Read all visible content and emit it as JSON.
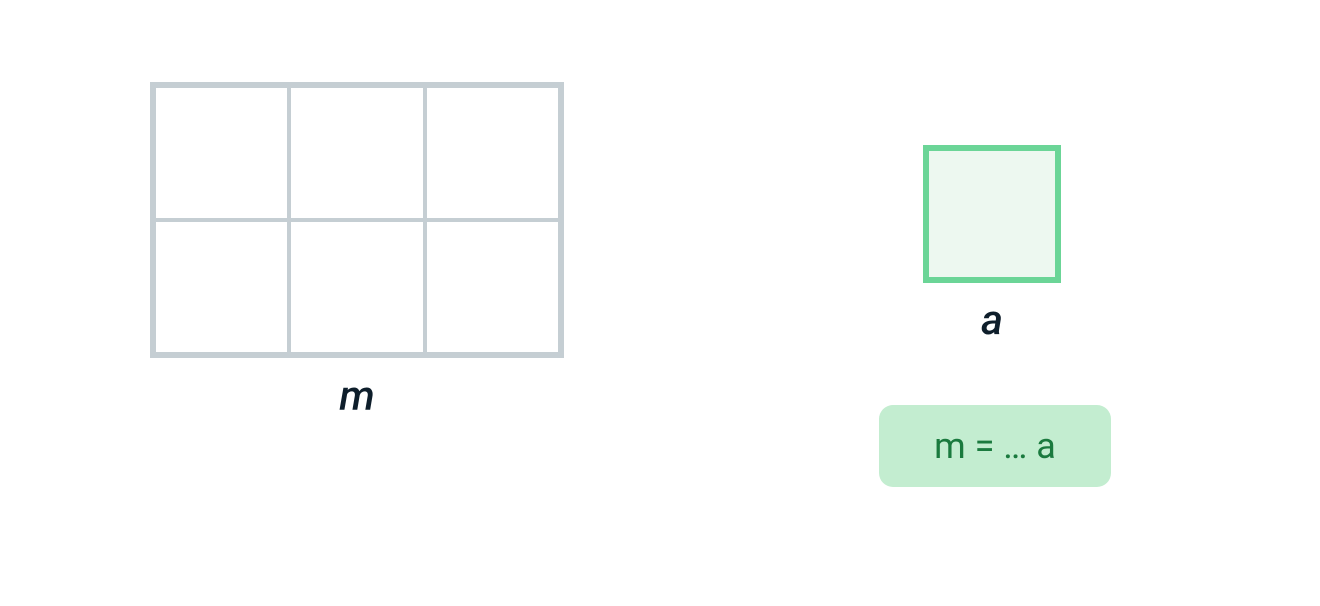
{
  "diagram": {
    "grid_m": {
      "rows": 2,
      "cols": 3,
      "label": "m"
    },
    "square_a": {
      "label": "a"
    },
    "equation": "m = … a"
  },
  "colors": {
    "grid_border": "#c5ced3",
    "square_border": "#6bd597",
    "square_fill": "#edf8f0",
    "equation_bg": "#c3edd0",
    "equation_text": "#1a7a3e",
    "label_text": "#0e1e2b"
  }
}
